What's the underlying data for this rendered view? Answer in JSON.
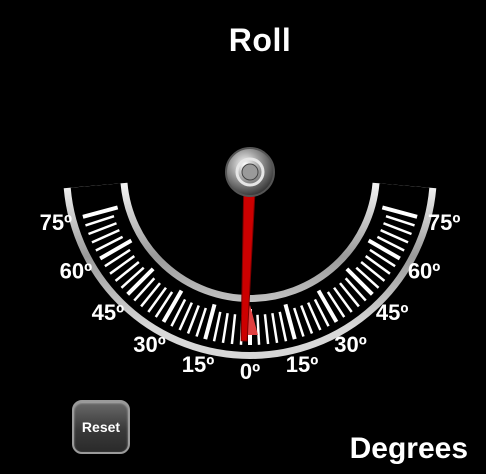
{
  "title": "Roll",
  "units": "Degrees",
  "reset_label": "Reset",
  "roll_degrees": -2,
  "scale": {
    "labels": [
      "75º",
      "60º",
      "45º",
      "30º",
      "15º",
      "0º",
      "15º",
      "30º",
      "45º",
      "60º",
      "75º"
    ],
    "max_degrees": 75
  },
  "colors": {
    "background": "#000000",
    "needle": "#cc0000",
    "zero_marker": "#e04040",
    "text": "#ffffff"
  },
  "icons": {
    "pivot": "needle-pivot-icon"
  }
}
